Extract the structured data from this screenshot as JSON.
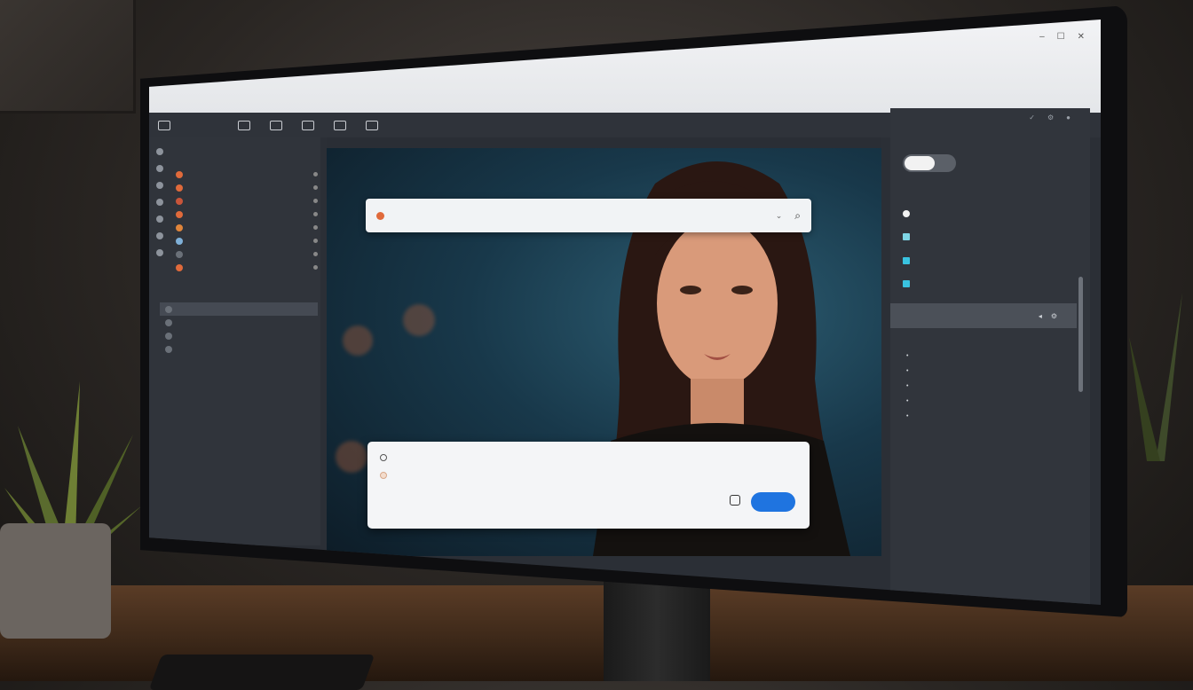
{
  "browser": {
    "url_text": "",
    "window_controls": [
      "–",
      "☐",
      "✕"
    ]
  },
  "toolbar": {
    "items": [
      "",
      "",
      "",
      "",
      "",
      "",
      "",
      "",
      ""
    ]
  },
  "sidebar": {
    "section_label": "",
    "contacts": [
      {
        "label": "",
        "color": "#e06a3b"
      },
      {
        "label": "",
        "color": "#e06a3b"
      },
      {
        "label": "",
        "color": "#c9553a"
      },
      {
        "label": "",
        "color": "#e06a3b"
      },
      {
        "label": "",
        "color": "#e0853b"
      },
      {
        "label": "",
        "color": "#7fb0d8"
      },
      {
        "label": "",
        "color": "#6a7078"
      },
      {
        "label": "",
        "color": "#e06a3b"
      }
    ],
    "threads": [
      "",
      "",
      "",
      ""
    ]
  },
  "canvas": {
    "tabs": [
      "",
      "",
      ""
    ]
  },
  "search": {
    "placeholder": ""
  },
  "caption": "",
  "chat": {
    "line1": "",
    "line2": "",
    "send_label": ""
  },
  "right_panel": {
    "header": "",
    "title": "",
    "toggle_value": "",
    "rows": [
      {
        "label": "",
        "value": "",
        "swatch": "#f2f2f2"
      },
      {
        "label": "",
        "value": "",
        "swatch": "#7fd6e6"
      },
      {
        "label": "",
        "value": "",
        "swatch": "#39c3e0"
      },
      {
        "label": "",
        "value": "",
        "swatch": "#39c3e0"
      }
    ],
    "section_title": "",
    "section_sub": "",
    "bullets": [
      "",
      "",
      "",
      "",
      ""
    ]
  },
  "colors": {
    "accent": "#1f74e0",
    "panel_bg": "#31353c",
    "canvas_bg": "#18384a"
  }
}
